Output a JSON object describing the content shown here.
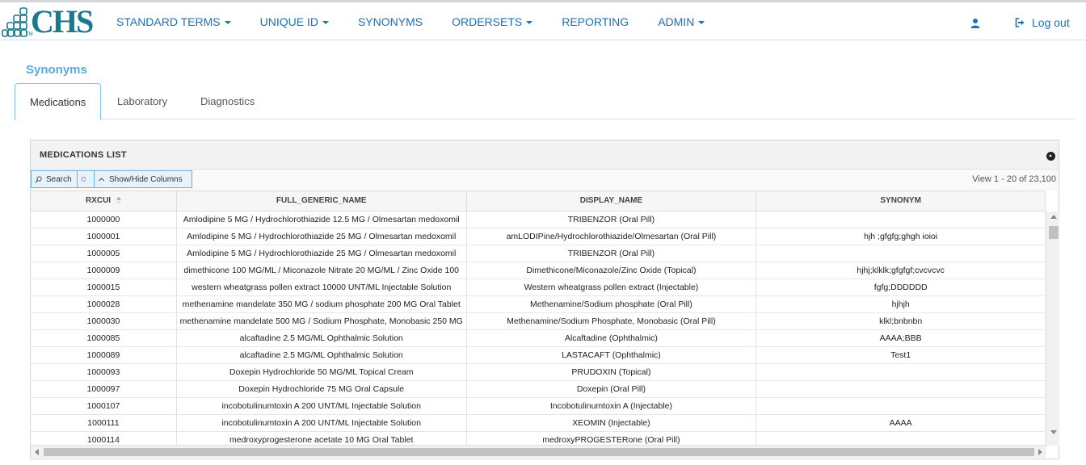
{
  "brand": {
    "logo_text": "CHS",
    "logo_tm": "TM",
    "color": "#1a7a8c"
  },
  "nav": {
    "items": [
      {
        "label": "STANDARD TERMS",
        "dropdown": true
      },
      {
        "label": "UNIQUE ID",
        "dropdown": true
      },
      {
        "label": "SYNONYMS",
        "dropdown": false
      },
      {
        "label": "ORDERSETS",
        "dropdown": true
      },
      {
        "label": "REPORTING",
        "dropdown": false
      },
      {
        "label": "ADMIN",
        "dropdown": true
      }
    ],
    "user_icon": "user-icon",
    "logout_label": "Log out",
    "link_color": "#1d6fb8"
  },
  "page": {
    "title": "Synonyms",
    "tabs": [
      "Medications",
      "Laboratory",
      "Diagnostics"
    ],
    "active_tab": "Medications"
  },
  "grid": {
    "title": "MEDICATIONS LIST",
    "search_label": "Search",
    "toggle_label": "Show/Hide Columns",
    "view_info": "View 1 - 20 of 23,100",
    "columns": [
      "RXCUI",
      "FULL_GENERIC_NAME",
      "DISPLAY_NAME",
      "SYNONYM"
    ],
    "sorted_column": "RXCUI",
    "rows": [
      [
        "1000000",
        "Amlodipine 5 MG / Hydrochlorothiazide 12.5 MG / Olmesartan medoxomil",
        "TRIBENZOR (Oral Pill)",
        ""
      ],
      [
        "1000001",
        "Amlodipine 5 MG / Hydrochlorothiazide 25 MG / Olmesartan medoxomil",
        "amLODIPine/Hydrochlorothiazide/Olmesartan (Oral Pill)",
        "hjh ;gfgfg;ghgh ioioi"
      ],
      [
        "1000005",
        "Amlodipine 5 MG / Hydrochlorothiazide 25 MG / Olmesartan medoxomil",
        "TRIBENZOR (Oral Pill)",
        ""
      ],
      [
        "1000009",
        "dimethicone 100 MG/ML / Miconazole Nitrate 20 MG/ML / Zinc Oxide 100",
        "Dimethicone/Miconazole/Zinc Oxide (Topical)",
        "hjhj;klklk;gfgfgf;cvcvcvc"
      ],
      [
        "1000015",
        "western wheatgrass pollen extract 10000 UNT/ML Injectable Solution",
        "Western wheatgrass pollen extract (Injectable)",
        "fgfg;DDDDDD"
      ],
      [
        "1000028",
        "methenamine mandelate 350 MG / sodium phosphate 200 MG Oral Tablet",
        "Methenamine/Sodium phosphate (Oral Pill)",
        "hjhjh"
      ],
      [
        "1000030",
        "methenamine mandelate 500 MG / Sodium Phosphate, Monobasic 250 MG",
        "Methenamine/Sodium Phosphate, Monobasic (Oral Pill)",
        "klkl;bnbnbn"
      ],
      [
        "1000085",
        "alcaftadine 2.5 MG/ML Ophthalmic Solution",
        "Alcaftadine (Ophthalmic)",
        "AAAA;BBB"
      ],
      [
        "1000089",
        "alcaftadine 2.5 MG/ML Ophthalmic Solution",
        "LASTACAFT (Ophthalmic)",
        "Test1"
      ],
      [
        "1000093",
        "Doxepin Hydrochloride 50 MG/ML Topical Cream",
        "PRUDOXIN (Topical)",
        ""
      ],
      [
        "1000097",
        "Doxepin Hydrochloride 75 MG Oral Capsule",
        "Doxepin (Oral Pill)",
        ""
      ],
      [
        "1000107",
        "incobotulinumtoxin A 200 UNT/ML Injectable Solution",
        "Incobotulinumtoxin A (Injectable)",
        ""
      ],
      [
        "1000111",
        "incobotulinumtoxin A 200 UNT/ML Injectable Solution",
        "XEOMIN (Injectable)",
        "AAAA"
      ],
      [
        "1000114",
        "medroxyprogesterone acetate 10 MG Oral Tablet",
        "medroxyPROGESTERone (Oral Pill)",
        ""
      ]
    ]
  }
}
